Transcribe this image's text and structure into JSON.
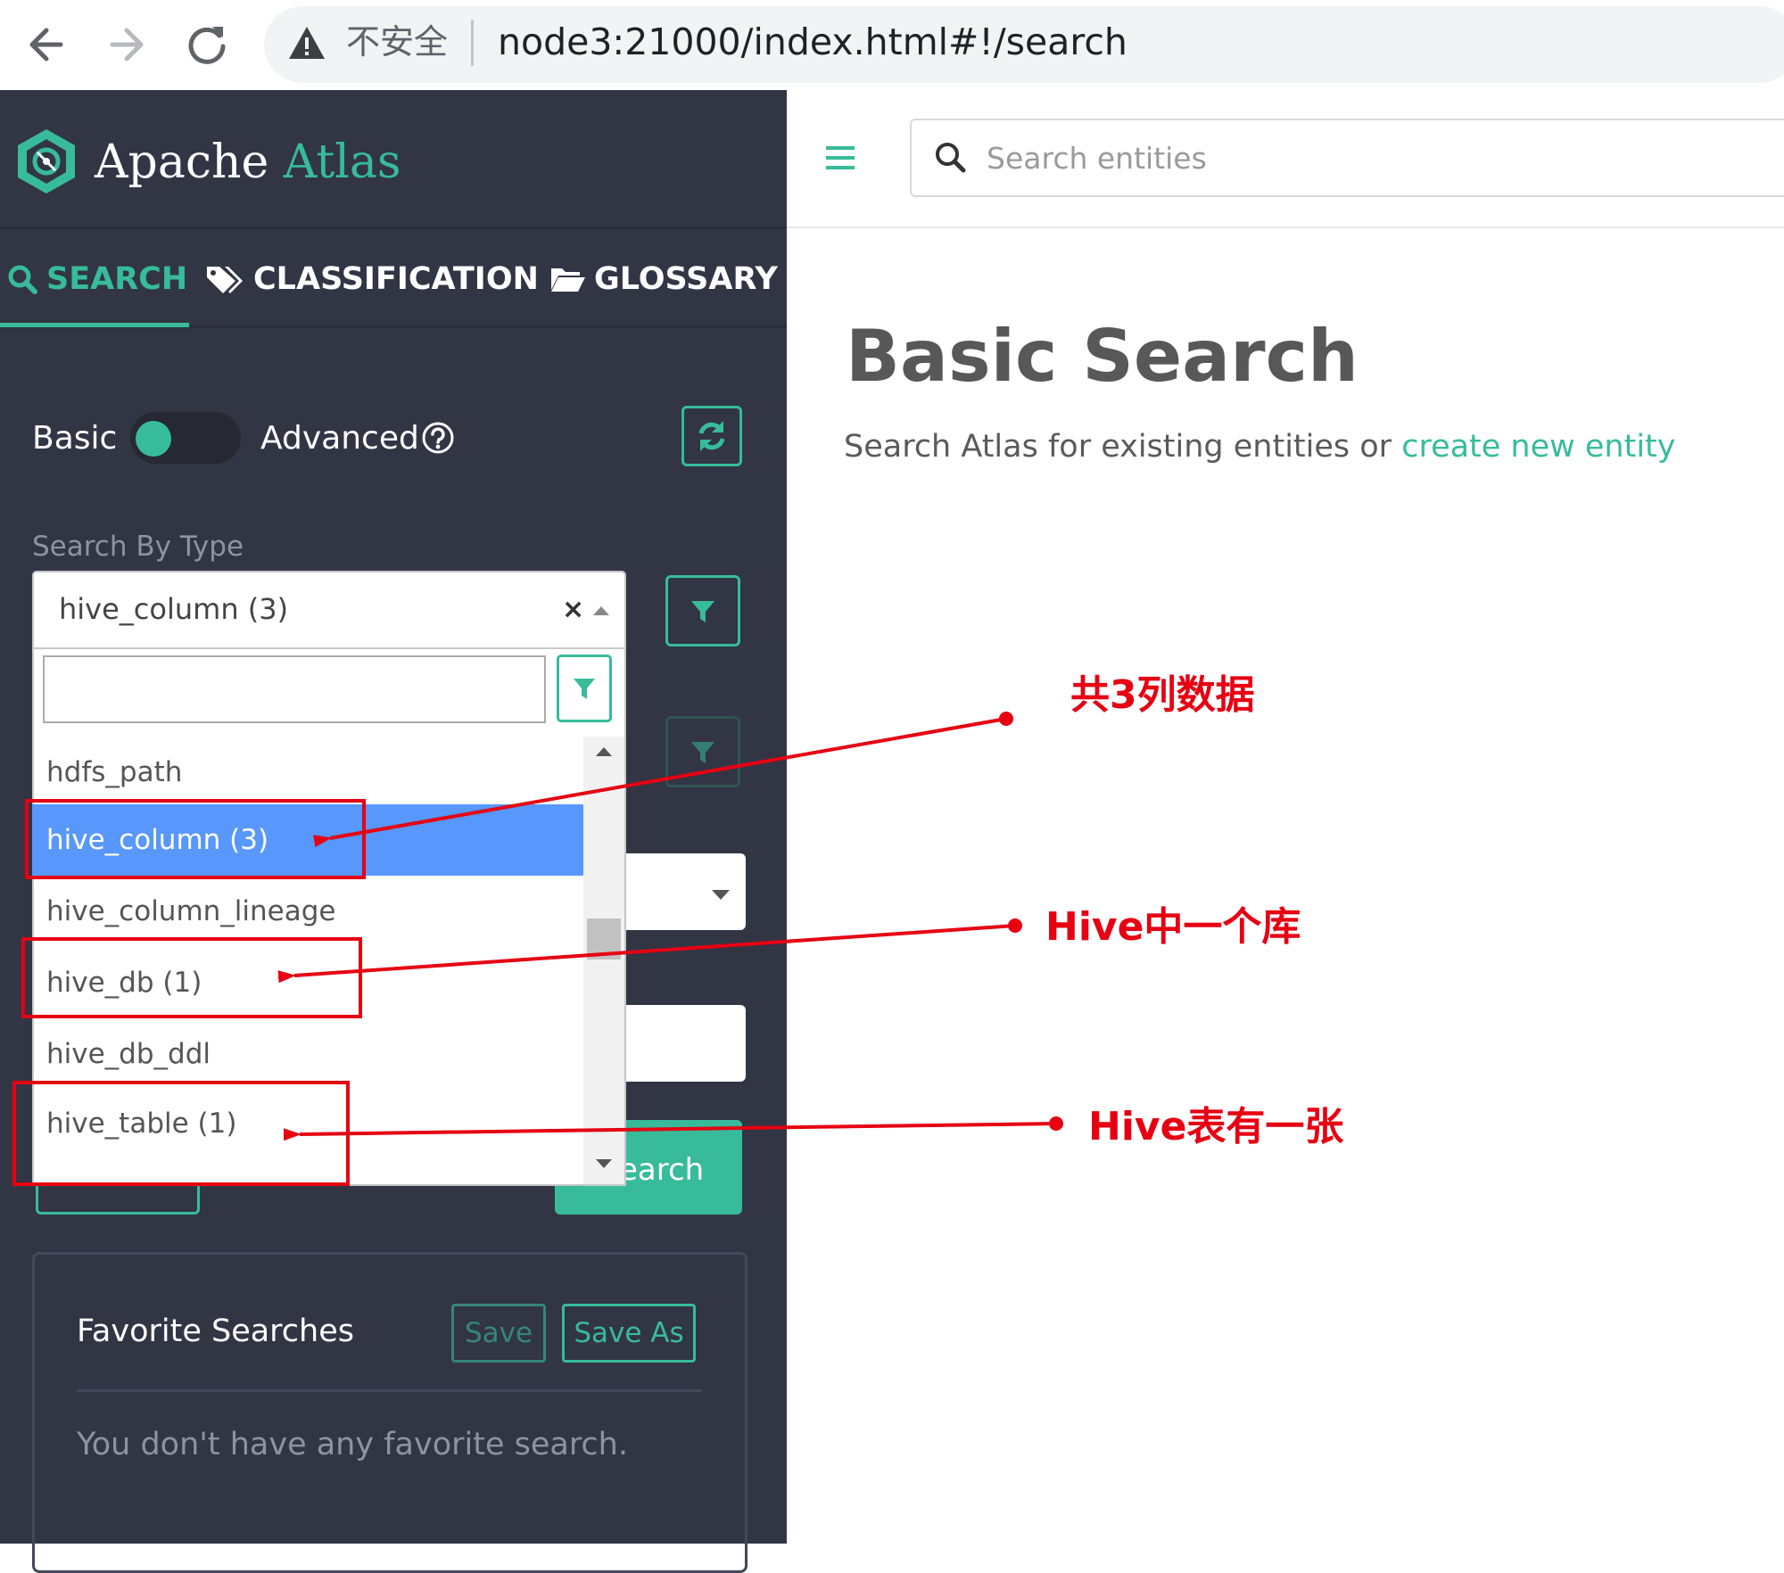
{
  "browser": {
    "insecure_label": "不安全",
    "url": "node3:21000/index.html#!/search"
  },
  "sidebar": {
    "brand": {
      "apache": "Apache",
      "atlas": "Atlas"
    },
    "tabs": [
      {
        "label": "SEARCH",
        "icon": "search-icon",
        "active": true
      },
      {
        "label": "CLASSIFICATION",
        "icon": "tags-icon",
        "active": false
      },
      {
        "label": "GLOSSARY",
        "icon": "folder-open-icon",
        "active": false
      }
    ],
    "mode": {
      "basic_label": "Basic",
      "advanced_label": "Advanced",
      "selected": "Basic"
    },
    "search_by_type": {
      "label": "Search By Type",
      "selected_value": "hive_column (3)",
      "clear_glyph": "×",
      "options": [
        "hdfs_path",
        "hive_column (3)",
        "hive_column_lineage",
        "hive_db (1)",
        "hive_db_ddl",
        "hive_table (1)"
      ],
      "highlighted": "hive_column (3)"
    },
    "search_button_label": "earch",
    "favorites": {
      "title": "Favorite Searches",
      "save_label": "Save",
      "save_as_label": "Save As",
      "empty_text": "You don't have any favorite search."
    }
  },
  "header": {
    "search_placeholder": "Search entities"
  },
  "main": {
    "title": "Basic Search",
    "subtitle_prefix": "Search Atlas for existing entities or ",
    "create_link": "create new entity"
  },
  "annotations": [
    {
      "label": "共3列数据",
      "target": "hive_column (3)"
    },
    {
      "label": "Hive中一个库",
      "target": "hive_db (1)"
    },
    {
      "label": "Hive表有一张",
      "target": "hive_table (1)"
    }
  ],
  "colors": {
    "sidebar_bg": "#323544",
    "accent": "#37bb9b",
    "selected_option": "#5897fb",
    "annotation": "#e60012"
  }
}
